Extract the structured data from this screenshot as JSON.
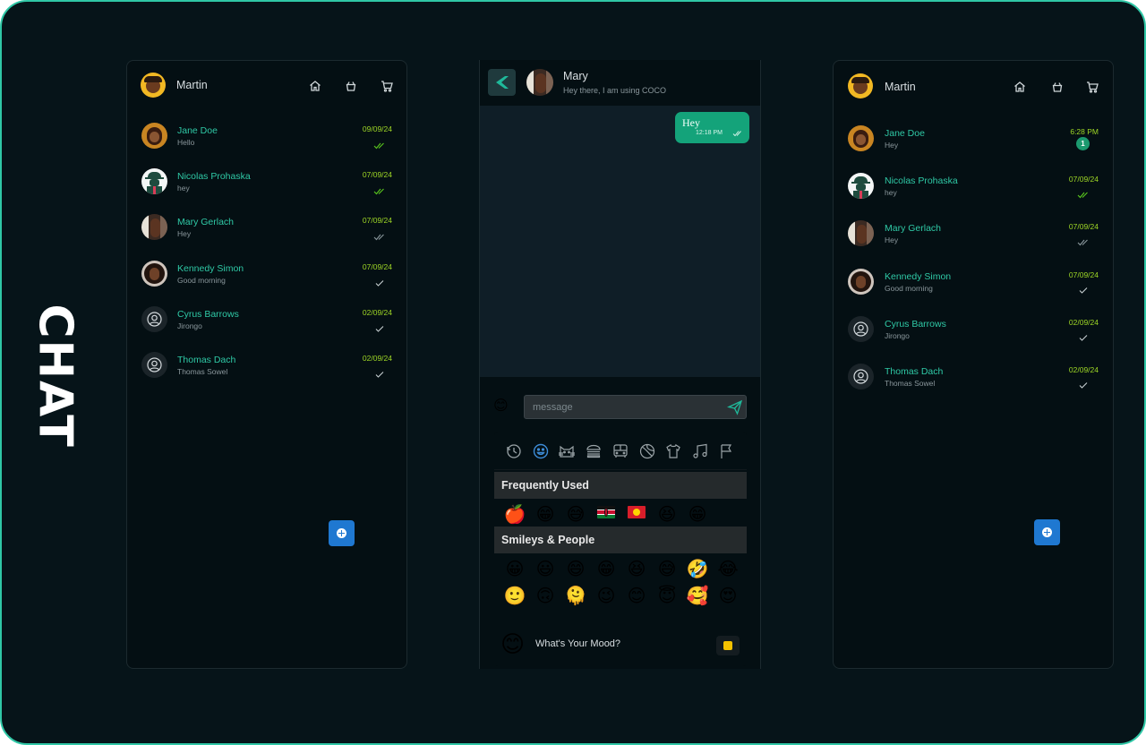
{
  "brand": "CHAT",
  "colors": {
    "accent": "#2fc9a6",
    "date": "#9fd826",
    "bubble": "#14a37a",
    "fab": "#1f78d1",
    "background": "#061419"
  },
  "left_panel": {
    "user": "Martin",
    "icons": [
      "home-icon",
      "bag-icon",
      "cart-icon"
    ],
    "contacts": [
      {
        "name": "Jane Doe",
        "message": "Hello",
        "date": "09/09/24",
        "status": "read"
      },
      {
        "name": "Nicolas Prohaska",
        "message": "hey",
        "date": "07/09/24",
        "status": "read"
      },
      {
        "name": "Mary Gerlach",
        "message": "Hey",
        "date": "07/09/24",
        "status": "delivered"
      },
      {
        "name": "Kennedy Simon",
        "message": "Good morning",
        "date": "07/09/24",
        "status": "sent"
      },
      {
        "name": "Cyrus Barrows",
        "message": "Jirongo",
        "date": "02/09/24",
        "status": "sent"
      },
      {
        "name": "Thomas Dach",
        "message": "Thomas Sowel",
        "date": "02/09/24",
        "status": "sent"
      }
    ]
  },
  "right_panel": {
    "user": "Martin",
    "contacts": [
      {
        "name": "Jane Doe",
        "message": "Hey",
        "date": "6:28 PM",
        "unread": "1"
      },
      {
        "name": "Nicolas Prohaska",
        "message": "hey",
        "date": "07/09/24",
        "status": "read"
      },
      {
        "name": "Mary Gerlach",
        "message": "Hey",
        "date": "07/09/24",
        "status": "delivered"
      },
      {
        "name": "Kennedy Simon",
        "message": "Good morning",
        "date": "07/09/24",
        "status": "sent"
      },
      {
        "name": "Cyrus Barrows",
        "message": "Jirongo",
        "date": "02/09/24",
        "status": "sent"
      },
      {
        "name": "Thomas Dach",
        "message": "Thomas Sowel",
        "date": "02/09/24",
        "status": "sent"
      }
    ]
  },
  "chat": {
    "contact_name": "Mary",
    "contact_status": "Hey there, I am using COCO",
    "message": {
      "text": "Hey",
      "time": "12:18 PM"
    },
    "input_placeholder": "message",
    "picker": {
      "categories": [
        "recent-icon",
        "smiley-icon",
        "cat-icon",
        "burger-icon",
        "bus-icon",
        "ball-icon",
        "shirt-icon",
        "music-icon",
        "flag-icon"
      ],
      "frequently_used_title": "Frequently Used",
      "smileys_title": "Smileys & People",
      "frequently_used": [
        "🍎",
        "😁",
        "😅",
        "flag-kenya",
        "flag-kyrgyzstan",
        "😆",
        "😁"
      ],
      "smileys_row1": [
        "😀",
        "😃",
        "😄",
        "😁",
        "😆",
        "😅",
        "🤣",
        "😂"
      ],
      "smileys_row2": [
        "🙂",
        "🙃",
        "🫠",
        "😉",
        "😊",
        "😇",
        "🥰",
        "😍"
      ],
      "smileys_row3": [
        "🤩",
        "😘",
        "😗",
        "☺",
        "😚",
        "😙",
        "🥲",
        "😋"
      ]
    },
    "mood": {
      "face": "😊",
      "label": "What's Your Mood?"
    }
  }
}
